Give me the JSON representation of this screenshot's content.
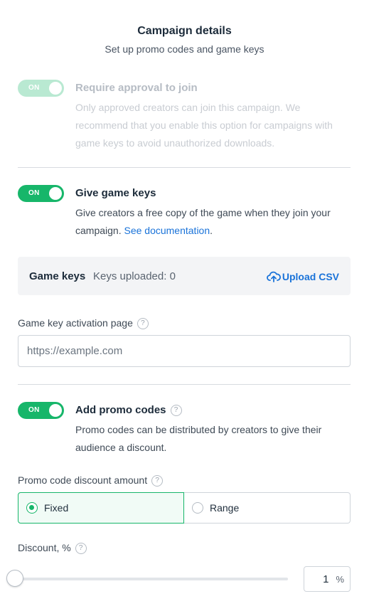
{
  "header": {
    "title": "Campaign details",
    "subtitle": "Set up promo codes and game keys"
  },
  "approval": {
    "toggle_label": "ON",
    "enabled": true,
    "disabled": true,
    "title": "Require approval to join",
    "description": "Only approved creators can join this campaign. We recommend that you enable this option for campaigns with game keys to avoid unauthorized downloads."
  },
  "game_keys": {
    "toggle_label": "ON",
    "enabled": true,
    "title": "Give game keys",
    "description": "Give creators a free copy of the game when they join your campaign.",
    "link_text": "See documentation",
    "link_suffix": ".",
    "box_label": "Game keys",
    "keys_uploaded": "Keys uploaded: 0",
    "upload_label": "Upload CSV"
  },
  "activation": {
    "label": "Game key activation page",
    "help": "?",
    "placeholder": "https://example.com",
    "value": ""
  },
  "promo": {
    "toggle_label": "ON",
    "enabled": true,
    "title": "Add promo codes",
    "help": "?",
    "description": "Promo codes can be distributed by creators to give their audience a discount."
  },
  "discount_amount": {
    "label": "Promo code discount amount",
    "help": "?",
    "options": [
      "Fixed",
      "Range"
    ],
    "selected": "Fixed"
  },
  "discount": {
    "label": "Discount, %",
    "help": "?",
    "value": "1",
    "unit": "%",
    "slider_fraction": 0.01
  },
  "colors": {
    "accent": "#17b66a",
    "link": "#1a73d9",
    "text": "#1c2b3a"
  }
}
